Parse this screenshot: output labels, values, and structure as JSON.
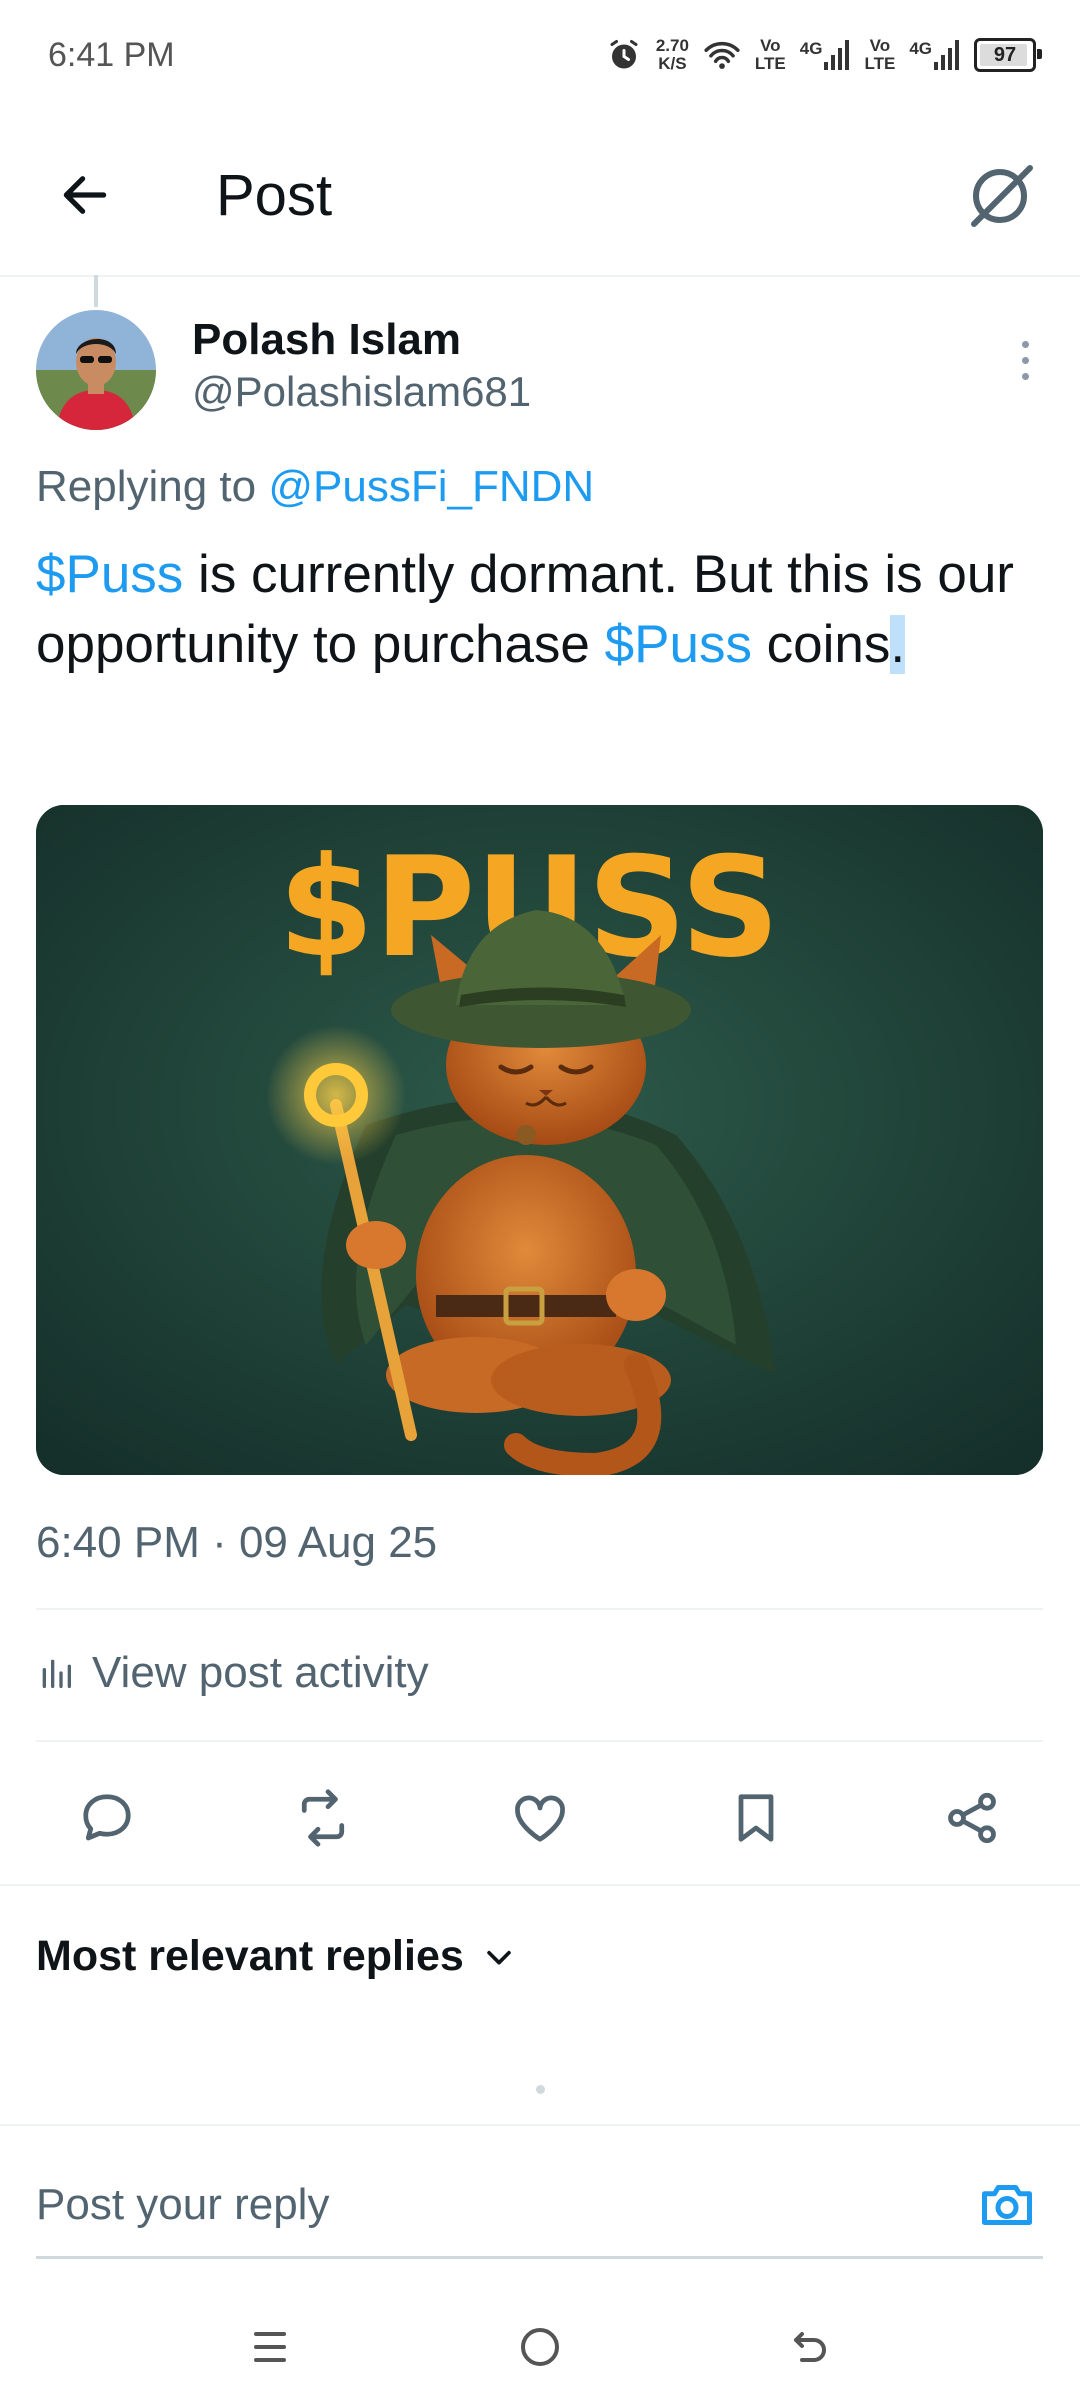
{
  "status_bar": {
    "time": "6:41 PM",
    "net_speed_value": "2.70",
    "net_speed_unit": "K/S",
    "sim1_top": "Vo",
    "sim1_bottom": "LTE",
    "sim1_net": "4G",
    "sim2_top": "Vo",
    "sim2_bottom": "LTE",
    "sim2_net": "4G",
    "battery": "97",
    "icons": [
      "alarm-icon",
      "wifi-icon",
      "signal-icon",
      "battery-icon"
    ]
  },
  "header": {
    "title": "Post",
    "back_icon": "arrow-left-icon",
    "grok_icon": "grok-icon"
  },
  "post": {
    "author_name": "Polash Islam",
    "author_handle": "@Polashislam681",
    "replying_prefix": "Replying to ",
    "replying_to": "@PussFi_FNDN",
    "text_tag1": "$Puss",
    "text_part1": " is currently dormant. But this is our opportunity to purchase ",
    "text_tag2": "$Puss",
    "text_part2": " coins",
    "text_end": ".",
    "media_caption": "$PUSS",
    "timestamp": "6:40 PM · 09 Aug 25",
    "view_activity": "View post activity"
  },
  "actions": [
    "reply-icon",
    "repost-icon",
    "like-icon",
    "bookmark-icon",
    "share-icon"
  ],
  "replies": {
    "sort_label": "Most relevant replies"
  },
  "composer": {
    "placeholder": "Post your reply",
    "camera_icon": "camera-icon"
  },
  "nav_bar": [
    "menu-icon",
    "home-icon",
    "back-icon"
  ],
  "colors": {
    "accent": "#1d9bf0",
    "text_primary": "#0f1419",
    "text_secondary": "#536471",
    "media_bg": "#1c3a30",
    "media_title": "#f5a623"
  }
}
